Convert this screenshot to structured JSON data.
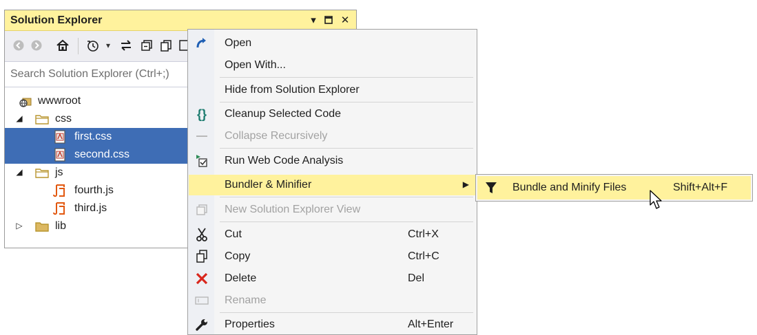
{
  "solution_explorer": {
    "title": "Solution Explorer",
    "title_buttons": [
      "dropdown-icon",
      "maximize-icon",
      "close-icon"
    ],
    "toolbar_icons": [
      "back-icon",
      "forward-icon",
      "home-icon",
      "history-icon",
      "dropdown-icon",
      "sync-icon",
      "collapse-all-icon",
      "copy-icon",
      "properties-icon"
    ],
    "search_placeholder": "Search Solution Explorer (Ctrl+;)",
    "tree": [
      {
        "label": "wwwroot",
        "icon": "globe-folder-icon",
        "level": 0,
        "expander": "none",
        "selected": false
      },
      {
        "label": "css",
        "icon": "folder-icon",
        "level": 0,
        "expander": "expanded",
        "selected": false
      },
      {
        "label": "first.css",
        "icon": "css-file-icon",
        "level": 1,
        "expander": "none",
        "selected": true
      },
      {
        "label": "second.css",
        "icon": "css-file-icon",
        "level": 1,
        "expander": "none",
        "selected": true
      },
      {
        "label": "js",
        "icon": "folder-icon",
        "level": 0,
        "expander": "expanded",
        "selected": false
      },
      {
        "label": "fourth.js",
        "icon": "js-file-icon",
        "level": 1,
        "expander": "none",
        "selected": false
      },
      {
        "label": "third.js",
        "icon": "js-file-icon",
        "level": 1,
        "expander": "none",
        "selected": false
      },
      {
        "label": "lib",
        "icon": "folder-icon",
        "level": 0,
        "expander": "collapsed",
        "selected": false
      }
    ]
  },
  "context_menu": {
    "items": [
      {
        "label": "Open",
        "icon": "open-arrow-icon",
        "shortcut": "",
        "enabled": true
      },
      {
        "label": "Open With...",
        "icon": "",
        "shortcut": "",
        "enabled": true
      },
      {
        "label": "Hide from Solution Explorer",
        "icon": "",
        "shortcut": "",
        "enabled": true
      },
      {
        "label": "Cleanup Selected Code",
        "icon": "braces-icon",
        "shortcut": "",
        "enabled": true
      },
      {
        "label": "Collapse Recursively",
        "icon": "dash-icon",
        "shortcut": "",
        "enabled": false
      },
      {
        "label": "Run Web Code Analysis",
        "icon": "code-analysis-icon",
        "shortcut": "",
        "enabled": true
      },
      {
        "label": "Bundler & Minifier",
        "icon": "",
        "shortcut": "",
        "enabled": true,
        "highlighted": true,
        "submenu": true
      },
      {
        "label": "New Solution Explorer View",
        "icon": "new-view-icon",
        "shortcut": "",
        "enabled": false
      },
      {
        "label": "Cut",
        "icon": "scissors-icon",
        "shortcut": "Ctrl+X",
        "enabled": true
      },
      {
        "label": "Copy",
        "icon": "copy-icon",
        "shortcut": "Ctrl+C",
        "enabled": true
      },
      {
        "label": "Delete",
        "icon": "delete-x-icon",
        "shortcut": "Del",
        "enabled": true
      },
      {
        "label": "Rename",
        "icon": "rename-icon",
        "shortcut": "",
        "enabled": false
      },
      {
        "label": "Properties",
        "icon": "wrench-icon",
        "shortcut": "Alt+Enter",
        "enabled": true
      }
    ]
  },
  "submenu": {
    "items": [
      {
        "label": "Bundle and Minify Files",
        "icon": "funnel-icon",
        "shortcut": "Shift+Alt+F",
        "highlighted": true
      }
    ]
  },
  "colors": {
    "title_bar": "#fff29d",
    "selection": "#3e6db5",
    "menu_highlight": "#fff29d",
    "menu_background": "#f5f5f5",
    "delete_red": "#d9261c",
    "braces_teal": "#1b7b6e",
    "js_orange": "#e2570e"
  }
}
